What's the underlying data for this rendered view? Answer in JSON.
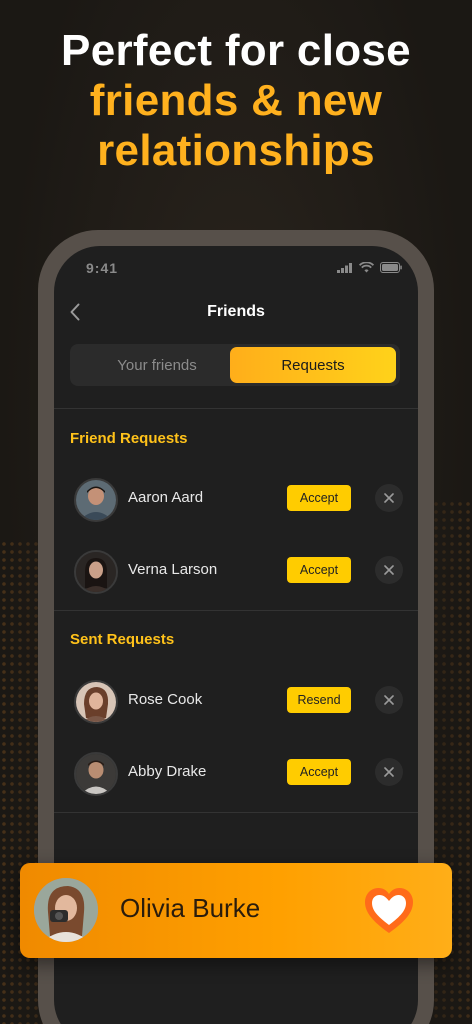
{
  "headline": {
    "line1": "Perfect for close",
    "line2": "friends & new",
    "line3": "relationships"
  },
  "status_bar": {
    "time": "9:41",
    "icons": [
      "signal-icon",
      "wifi-icon",
      "battery-icon"
    ]
  },
  "nav": {
    "title": "Friends",
    "back_icon": "chevron-left-icon"
  },
  "tabs": [
    {
      "label": "Your friends",
      "active": false
    },
    {
      "label": "Requests",
      "active": true
    }
  ],
  "friend_requests": {
    "title": "Friend Requests",
    "items": [
      {
        "name": "Aaron Aard",
        "action": "Accept"
      },
      {
        "name": "Verna Larson",
        "action": "Accept"
      }
    ]
  },
  "sent_requests": {
    "title": "Sent Requests",
    "items": [
      {
        "name": "Rose Cook",
        "action": "Resend"
      },
      {
        "name": "Abby Drake",
        "action": "Accept"
      }
    ]
  },
  "notification": {
    "name": "Olivia Burke",
    "icon": "heart-icon"
  },
  "colors": {
    "accent": "#ffb11e",
    "button": "#ffcc00",
    "card": "#ffa000",
    "background": "#1e1a16"
  }
}
